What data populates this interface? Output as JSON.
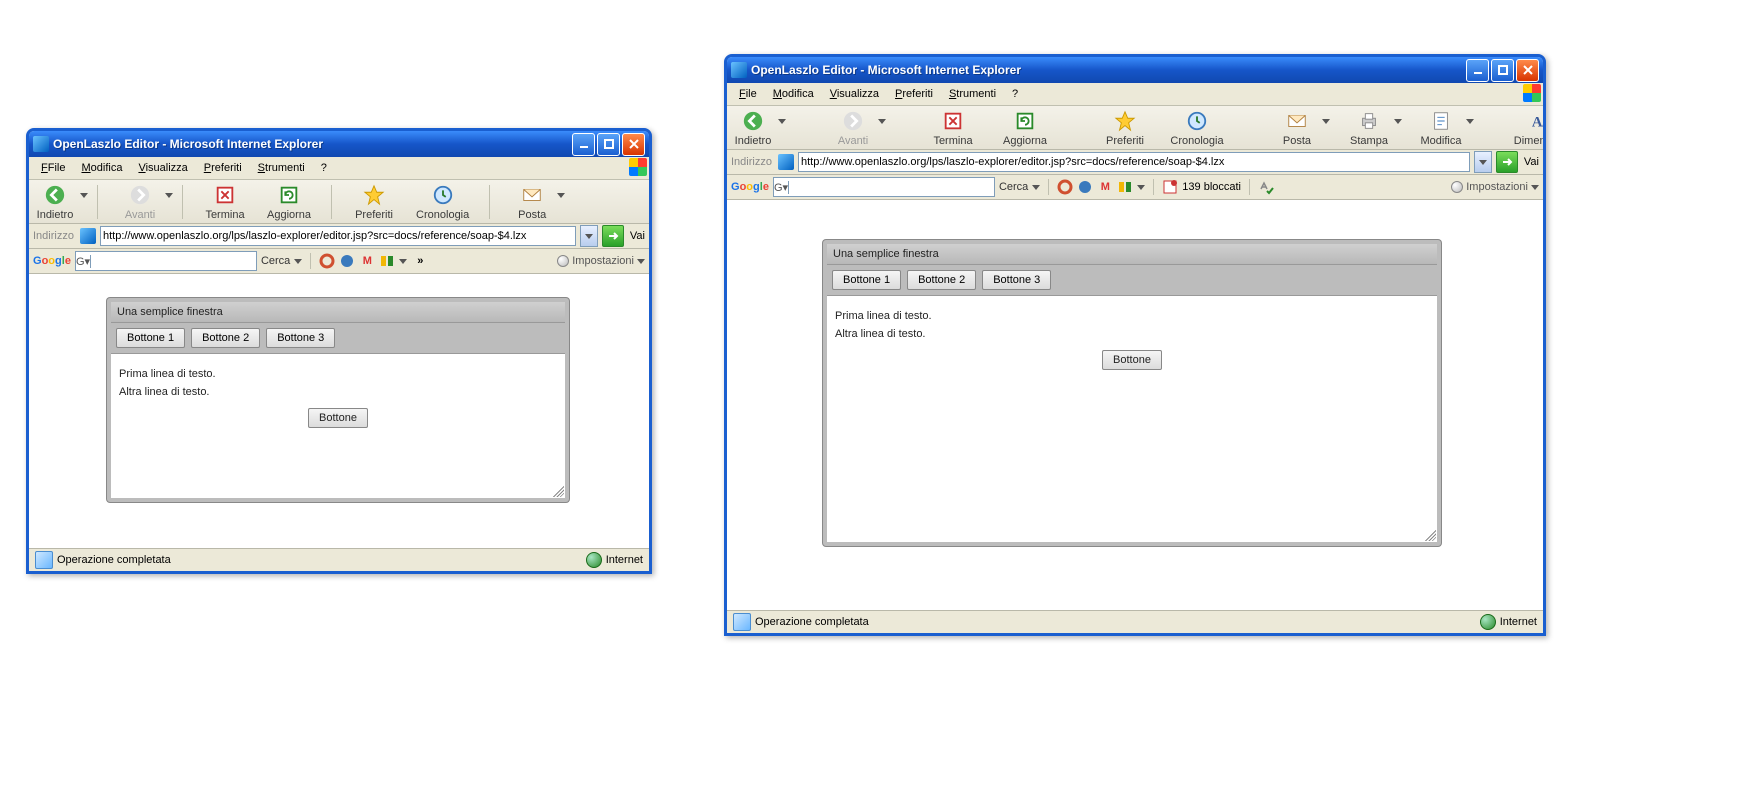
{
  "left": {
    "title": "OpenLaszlo Editor - Microsoft Internet Explorer",
    "menus": [
      "File",
      "Modifica",
      "Visualizza",
      "Preferiti",
      "Strumenti",
      "?"
    ],
    "toolbar": {
      "back": "Indietro",
      "forward": "Avanti",
      "stop": "Termina",
      "refresh": "Aggiorna",
      "favorites": "Preferiti",
      "history": "Cronologia",
      "mail": "Posta"
    },
    "address": {
      "label": "Indirizzo",
      "url": "http://www.openlaszlo.org/lps/laszlo-explorer/editor.jsp?src=docs/reference/soap-$4.lzx",
      "go": "Vai"
    },
    "google": {
      "search_label": "Cerca",
      "settings": "Impostazioni",
      "overflow": "»"
    },
    "laszlo": {
      "title": "Una semplice finestra",
      "buttons": [
        "Bottone 1",
        "Bottone 2",
        "Bottone 3"
      ],
      "line1": "Prima linea di testo.",
      "line2": "Altra linea di testo.",
      "center_button": "Bottone"
    },
    "status": {
      "text": "Operazione completata",
      "zone": "Internet"
    }
  },
  "right": {
    "title": "OpenLaszlo Editor - Microsoft Internet Explorer",
    "menus": [
      "File",
      "Modifica",
      "Visualizza",
      "Preferiti",
      "Strumenti",
      "?"
    ],
    "toolbar": {
      "back": "Indietro",
      "forward": "Avanti",
      "stop": "Termina",
      "refresh": "Aggiorna",
      "favorites": "Preferiti",
      "history": "Cronologia",
      "mail": "Posta",
      "print": "Stampa",
      "edit": "Modifica",
      "size": "Dimensioni"
    },
    "address": {
      "label": "Indirizzo",
      "url": "http://www.openlaszlo.org/lps/laszlo-explorer/editor.jsp?src=docs/reference/soap-$4.lzx",
      "go": "Vai"
    },
    "google": {
      "search_label": "Cerca",
      "blocked": "139 bloccati",
      "settings": "Impostazioni"
    },
    "laszlo": {
      "title": "Una semplice finestra",
      "buttons": [
        "Bottone 1",
        "Bottone 2",
        "Bottone 3"
      ],
      "line1": "Prima linea di testo.",
      "line2": "Altra linea di testo.",
      "center_button": "Bottone"
    },
    "status": {
      "text": "Operazione completata",
      "zone": "Internet"
    }
  }
}
